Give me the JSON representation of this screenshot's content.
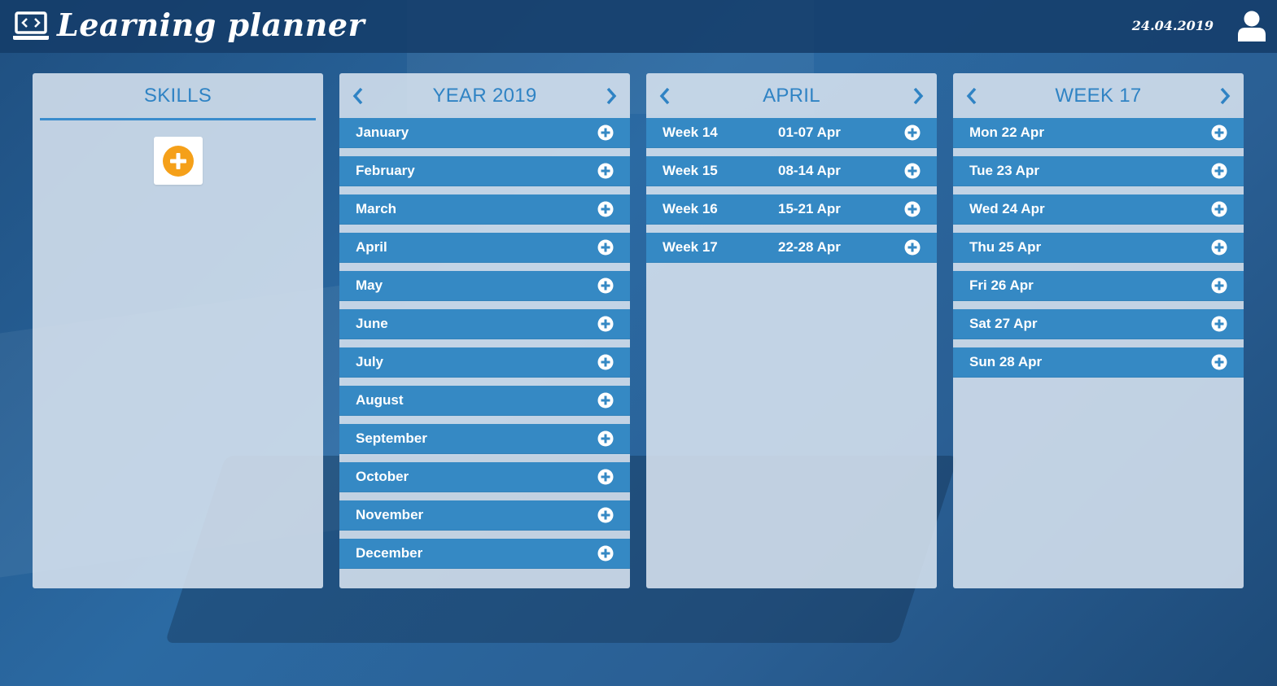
{
  "header": {
    "title": "Learning planner",
    "date": "24.04.2019",
    "logo_icon": "laptop-code-icon",
    "user_icon": "user-icon"
  },
  "colors": {
    "accent": "#3589c4",
    "title_blue": "#2f83c4",
    "add_orange": "#f5a019"
  },
  "skills": {
    "title": "SKILLS",
    "add_icon": "plus-circle-icon"
  },
  "year": {
    "title": "YEAR 2019",
    "months": [
      "January",
      "February",
      "March",
      "April",
      "May",
      "June",
      "July",
      "August",
      "September",
      "October",
      "November",
      "December"
    ]
  },
  "month": {
    "title": "APRIL",
    "weeks": [
      {
        "label": "Week 14",
        "range": "01-07 Apr"
      },
      {
        "label": "Week 15",
        "range": "08-14 Apr"
      },
      {
        "label": "Week 16",
        "range": "15-21 Apr"
      },
      {
        "label": "Week 17",
        "range": "22-28 Apr"
      }
    ]
  },
  "week": {
    "title": "WEEK 17",
    "days": [
      "Mon 22 Apr",
      "Tue 23 Apr",
      "Wed 24 Apr",
      "Thu 25 Apr",
      "Fri 26 Apr",
      "Sat 27 Apr",
      "Sun 28 Apr"
    ]
  }
}
